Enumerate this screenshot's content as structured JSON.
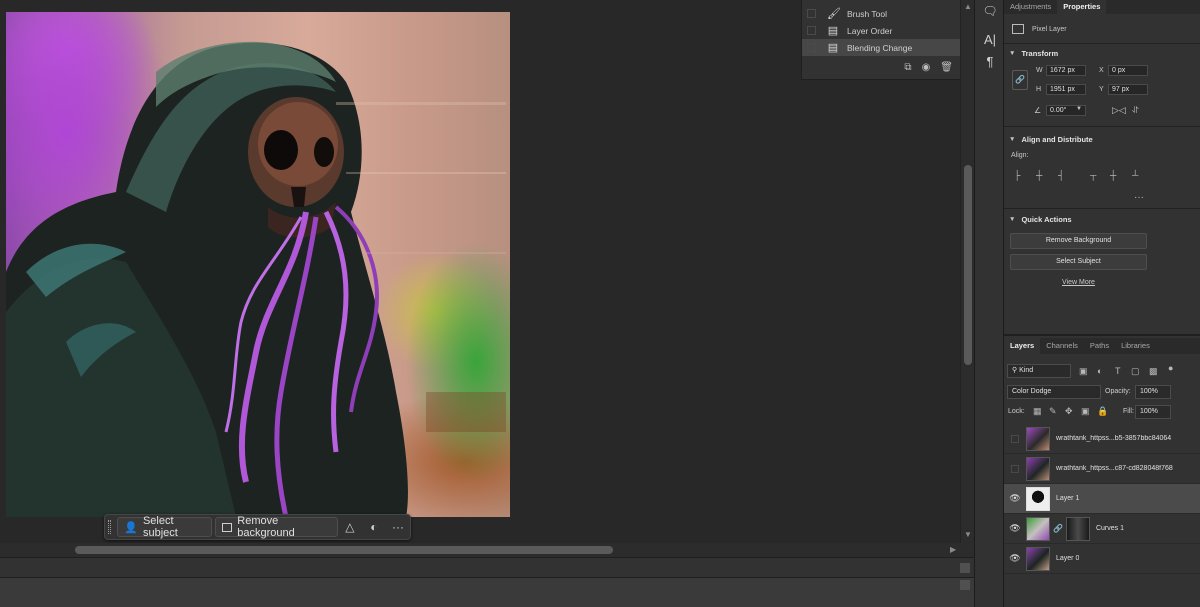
{
  "taskbar": {
    "select_subject": "Select subject",
    "remove_background": "Remove background",
    "more": "···"
  },
  "history": {
    "items": [
      {
        "label": "Brush Tool",
        "icon": "brush-icon"
      },
      {
        "label": "Layer Order",
        "icon": "document-icon"
      },
      {
        "label": "Blending Change",
        "icon": "document-icon",
        "selected": true
      }
    ]
  },
  "panel_tabs": {
    "adjustments": "Adjustments",
    "properties": "Properties"
  },
  "properties": {
    "layer_type": "Pixel Layer",
    "transform": {
      "title": "Transform",
      "w_label": "W",
      "w_value": "1672 px",
      "h_label": "H",
      "h_value": "1951 px",
      "x_label": "X",
      "x_value": "0 px",
      "y_label": "Y",
      "y_value": "97 px",
      "angle_value": "0.00°"
    },
    "align": {
      "title": "Align and Distribute",
      "align_label": "Align:"
    },
    "quick_actions": {
      "title": "Quick Actions",
      "remove_background": "Remove Background",
      "select_subject": "Select Subject",
      "view_more": "View More"
    }
  },
  "layers_tabs": {
    "layers": "Layers",
    "channels": "Channels",
    "paths": "Paths",
    "libraries": "Libraries"
  },
  "layers": {
    "filter_kind": "Kind",
    "blend_mode": "Color Dodge",
    "opacity_label": "Opacity:",
    "opacity_value": "100%",
    "lock_label": "Lock:",
    "fill_label": "Fill:",
    "fill_value": "100%",
    "items": [
      {
        "name": "wrathtank_httpss...b5-3857bbc84064",
        "visible": false
      },
      {
        "name": "wrathtank_httpss...c87-cd828048f768",
        "visible": false
      },
      {
        "name": "Layer 1",
        "visible": true,
        "selected": true
      },
      {
        "name": "Curves 1",
        "visible": true
      },
      {
        "name": "Layer 0",
        "visible": true
      }
    ]
  },
  "colors": {
    "canvas_bg": "#282828",
    "panel_bg": "#323232",
    "selected_row": "#4b4b4b",
    "art_purple": "#b046d6",
    "art_green": "#39a53a"
  }
}
